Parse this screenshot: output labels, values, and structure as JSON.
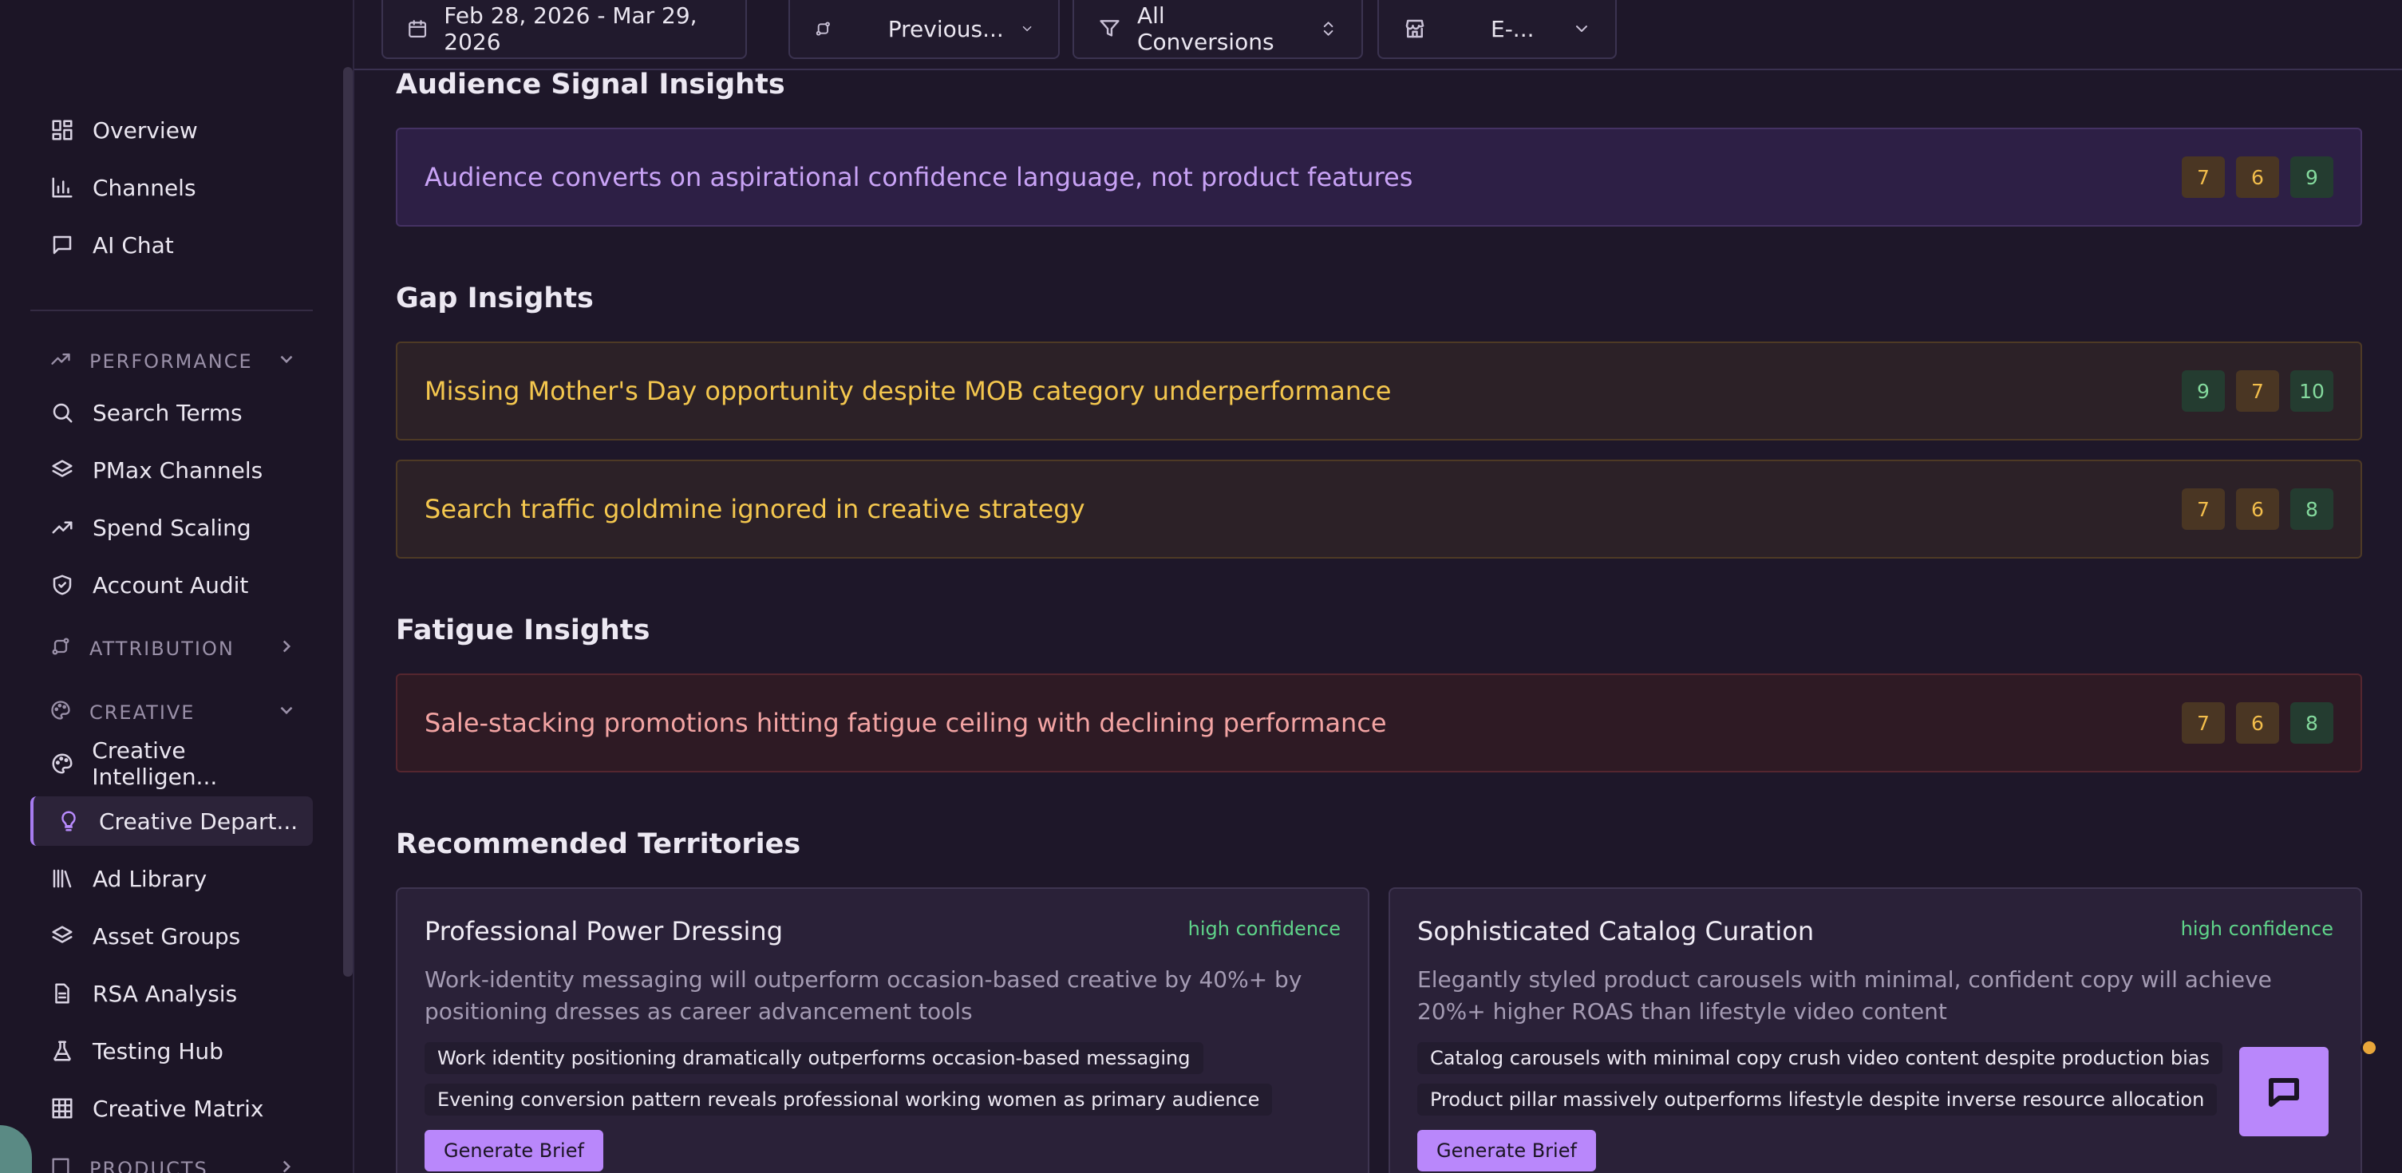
{
  "topbar": {
    "date_range": "Feb 28, 2026 - Mar 29, 2026",
    "compare": "Previous...",
    "conversions": "All Conversions",
    "store": "E-..."
  },
  "sidebar": {
    "top_items": [
      {
        "label": "Overview",
        "icon": "grid-icon"
      },
      {
        "label": "Channels",
        "icon": "bar-chart-icon"
      },
      {
        "label": "AI Chat",
        "icon": "message-icon"
      }
    ],
    "sections": {
      "performance": "PERFORMANCE",
      "attribution": "ATTRIBUTION",
      "creative": "CREATIVE",
      "products": "PRODUCTS"
    },
    "performance_items": [
      {
        "label": "Search Terms",
        "icon": "search-icon"
      },
      {
        "label": "PMax Channels",
        "icon": "layers-icon"
      },
      {
        "label": "Spend Scaling",
        "icon": "trend-up-icon"
      },
      {
        "label": "Account Audit",
        "icon": "shield-check-icon"
      }
    ],
    "creative_items": [
      {
        "label": "Creative Intelligen...",
        "icon": "palette-icon"
      },
      {
        "label": "Creative Depart...",
        "icon": "lightbulb-icon",
        "active": true
      },
      {
        "label": "Ad Library",
        "icon": "library-icon"
      },
      {
        "label": "Asset Groups",
        "icon": "layers-icon"
      },
      {
        "label": "RSA Analysis",
        "icon": "document-icon"
      },
      {
        "label": "Testing Hub",
        "icon": "flask-icon"
      },
      {
        "label": "Creative Matrix",
        "icon": "table-icon"
      }
    ]
  },
  "main": {
    "audience_title": "Audience Signal Insights",
    "audience": [
      {
        "text": "Audience converts on aspirational confidence language, not product features",
        "scores": [
          "7",
          "6",
          "9"
        ]
      }
    ],
    "gap_title": "Gap Insights",
    "gap": [
      {
        "text": "Missing Mother's Day opportunity despite MOB category underperformance",
        "scores": [
          "9",
          "7",
          "10"
        ]
      },
      {
        "text": "Search traffic goldmine ignored in creative strategy",
        "scores": [
          "7",
          "6",
          "8"
        ]
      }
    ],
    "fatigue_title": "Fatigue Insights",
    "fatigue": [
      {
        "text": "Sale-stacking promotions hitting fatigue ceiling with declining performance",
        "scores": [
          "7",
          "6",
          "8"
        ]
      }
    ],
    "territories_title": "Recommended Territories",
    "territories": [
      {
        "title": "Professional Power Dressing",
        "confidence": "high confidence",
        "description": "Work-identity messaging will outperform occasion-based creative by 40%+ by positioning dresses as career advancement tools",
        "points": [
          "Work identity positioning dramatically outperforms occasion-based messaging",
          "Evening conversion pattern reveals professional working women as primary audience"
        ],
        "button": "Generate Brief"
      },
      {
        "title": "Sophisticated Catalog Curation",
        "confidence": "high confidence",
        "description": "Elegantly styled product carousels with minimal, confident copy will achieve 20%+ higher ROAS than lifestyle video content",
        "points": [
          "Catalog carousels with minimal copy crush video content despite production bias",
          "Product pillar massively outperforms lifestyle despite inverse resource allocation"
        ],
        "button": "Generate Brief"
      }
    ]
  },
  "colors": {
    "accent": "#b987fb",
    "amber": "#f4c74e",
    "green": "#84d99d",
    "red": "#f3a4a3"
  }
}
